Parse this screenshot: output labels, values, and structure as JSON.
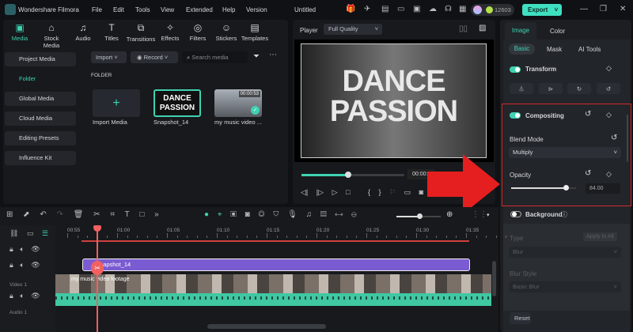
{
  "app": {
    "name": "Wondershare Filmora",
    "project": "Untitled",
    "credits": "12603",
    "export_label": "Export"
  },
  "menu": [
    "File",
    "Edit",
    "Tools",
    "View",
    "Extended",
    "Help",
    "Version"
  ],
  "tabs": [
    "Media",
    "Stock Media",
    "Audio",
    "Titles",
    "Transitions",
    "Effects",
    "Filters",
    "Stickers",
    "Templates"
  ],
  "sidebar": [
    "Project Media",
    "Folder",
    "Global Media",
    "Cloud Media",
    "Editing Presets",
    "Influence Kit"
  ],
  "media": {
    "import_label": "Import",
    "record_label": "Record",
    "search_placeholder": "Search media",
    "folder_heading": "FOLDER",
    "items": [
      {
        "name": "Import Media"
      },
      {
        "name": "Snapshot_14",
        "text": "DANCE PASSION"
      },
      {
        "name": "my music video ...",
        "duration": "00:00:53"
      }
    ]
  },
  "player": {
    "label": "Player",
    "quality": "Full Quality",
    "overlay_text": "DANCE PASSION",
    "timecode": "00:00:5",
    "progress": 0.45
  },
  "inspector": {
    "tabs": [
      "Image",
      "Color"
    ],
    "subtabs": [
      "Basic",
      "Mask",
      "AI Tools"
    ],
    "transform": "Transform",
    "compositing": "Compositing",
    "blend_mode_label": "Blend Mode",
    "blend_mode": "Multiply",
    "opacity_label": "Opacity",
    "opacity": "84.00",
    "opacity_value": 84,
    "background": "Background",
    "type_label": "Type",
    "apply_all": "Apply to All",
    "type_value": "Blur",
    "blur_style_label": "Blur Style",
    "blur_style": "Basic Blur",
    "reset": "Reset"
  },
  "timeline": {
    "ruler": [
      "00:55",
      "01:00",
      "01:05",
      "01:10",
      "01:15",
      "01:20",
      "01:25",
      "01:30",
      "01:35"
    ],
    "clip_title": "Snapshot_14",
    "clip_video": "my music video footage",
    "track_video": "Video 1",
    "track_audio": "Audio 1"
  },
  "colors": {
    "accent": "#3fd2b2",
    "highlight": "#e02020",
    "clip": "#7b5bd1"
  }
}
